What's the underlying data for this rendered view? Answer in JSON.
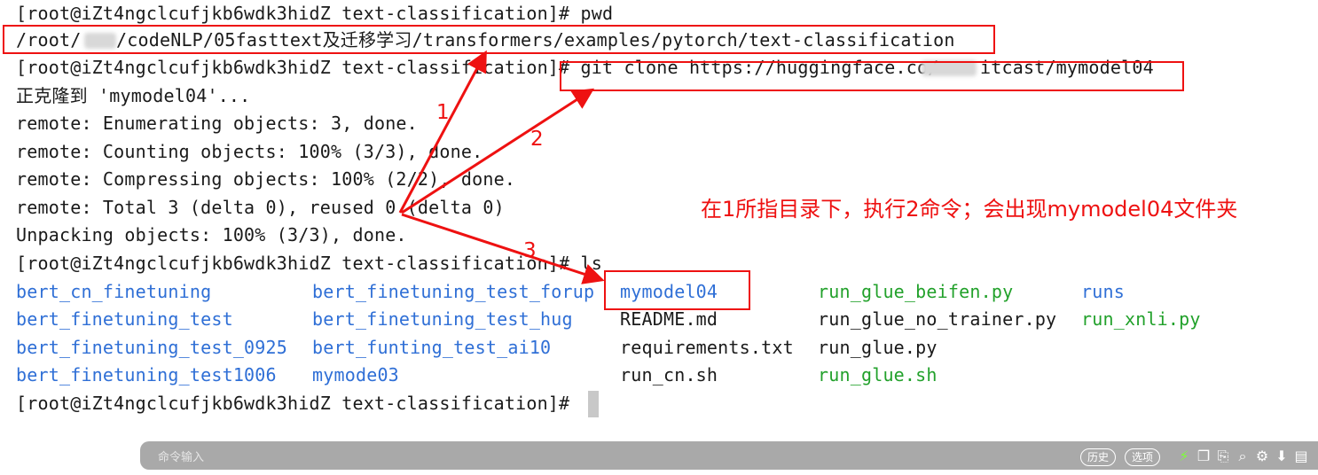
{
  "terminal": {
    "lines": [
      "[root@iZt4ngclcufjkb6wdk3hidZ text-classification]# pwd",
      "/root/",
      "/codeNLP/05fasttext及迁移学习/transformers/examples/pytorch/text-classification",
      "[root@iZt4ngclcufjkb6wdk3hidZ text-classification]# git clone https://huggingface.co/",
      "itcast/mymodel04",
      "正克隆到 'mymodel04'...",
      "remote: Enumerating objects: 3, done.",
      "remote: Counting objects: 100% (3/3), done.",
      "remote: Compressing objects: 100% (2/2), done.",
      "remote: Total 3 (delta 0), reused 0 (delta 0)",
      "Unpacking objects: 100% (3/3), done.",
      "[root@iZt4ngclcufjkb6wdk3hidZ text-classification]# ls",
      "[root@iZt4ngclcufjkb6wdk3hidZ text-classification]# "
    ],
    "ls": [
      [
        "bert_cn_finetuning",
        "bert_finetuning_test_forup",
        "mymodel04",
        "run_glue_beifen.py",
        "runs"
      ],
      [
        "bert_finetuning_test",
        "bert_finetuning_test_hug",
        "README.md",
        "run_glue_no_trainer.py",
        "run_xnli.py"
      ],
      [
        "bert_finetuning_test_0925",
        "bert_funting_test_ai10",
        "requirements.txt",
        "run_glue.py",
        ""
      ],
      [
        "bert_finetuning_test1006",
        "mymode03",
        "run_cn.sh",
        "run_glue.sh",
        ""
      ]
    ],
    "ls_kinds": [
      [
        "dir",
        "dir",
        "dir",
        "exec",
        "dir"
      ],
      [
        "dir",
        "dir",
        "file",
        "file",
        "exec"
      ],
      [
        "dir",
        "dir",
        "file",
        "file",
        ""
      ],
      [
        "dir",
        "dir",
        "file",
        "exec",
        ""
      ]
    ]
  },
  "annotations": {
    "arrow_labels": [
      "1",
      "2",
      "3"
    ],
    "note": "在1所指目录下，执行2命令；会出现mymodel04文件夹",
    "color": "#ee1111"
  },
  "command_bar": {
    "placeholder": "命令输入",
    "history_label": "历史",
    "options_label": "选项",
    "icons": [
      "lightning-icon",
      "copy-icon",
      "paste-icon",
      "search-icon",
      "gear-icon",
      "download-icon",
      "folder-icon"
    ]
  },
  "colors": {
    "directory": "#2f6fd6",
    "executable": "#22a12b",
    "text": "#1a1a1a",
    "command_bar": "#a9a9a9"
  }
}
